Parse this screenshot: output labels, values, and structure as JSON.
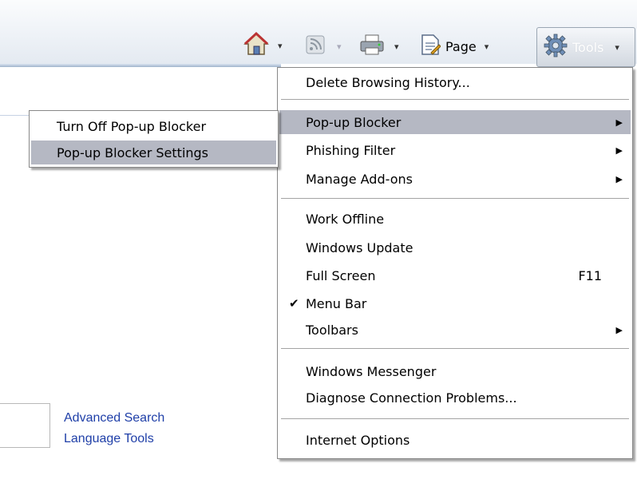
{
  "toolbar": {
    "home_icon": "home-icon",
    "feeds_icon": "feeds-icon",
    "print_icon": "print-icon",
    "page_icon": "page-icon",
    "page_label": "Page",
    "tools_icon": "gear-icon",
    "tools_label": "Tools",
    "dropdown_glyph": "▾"
  },
  "tools_menu": {
    "items": [
      {
        "label": "Delete Browsing History..."
      },
      {
        "label": "Pop-up Blocker",
        "submenu": true,
        "highlighted": true
      },
      {
        "label": "Phishing Filter",
        "submenu": true
      },
      {
        "label": "Manage Add-ons",
        "submenu": true
      },
      {
        "label": "Work Offline"
      },
      {
        "label": "Windows Update"
      },
      {
        "label": "Full Screen",
        "shortcut": "F11"
      },
      {
        "label": "Menu Bar",
        "checked": true
      },
      {
        "label": "Toolbars",
        "submenu": true
      },
      {
        "label": "Windows Messenger"
      },
      {
        "label": "Diagnose Connection Problems..."
      },
      {
        "label": "Internet Options"
      }
    ],
    "arrow_glyph": "▶",
    "check_glyph": "✔"
  },
  "popup_submenu": {
    "items": [
      {
        "label": "Turn Off Pop-up Blocker"
      },
      {
        "label": "Pop-up Blocker Settings",
        "highlighted": true
      }
    ]
  },
  "page_links": {
    "advanced_search": "Advanced Search",
    "language_tools": "Language Tools"
  },
  "colors": {
    "menu_highlight": "#b5b8c3",
    "link": "#1f3fa8"
  }
}
